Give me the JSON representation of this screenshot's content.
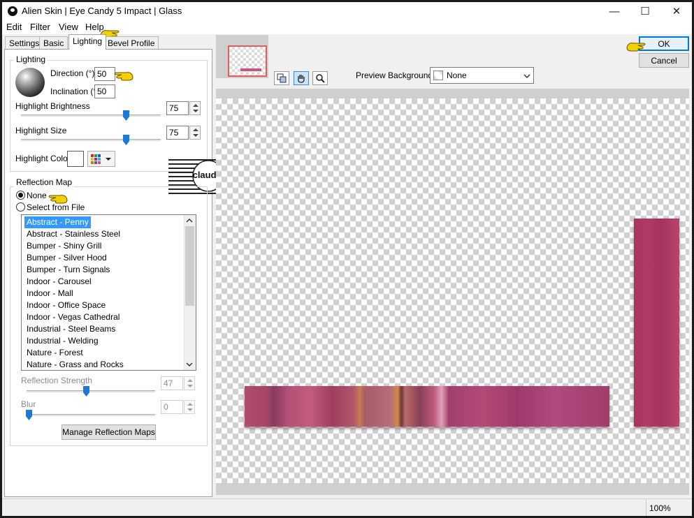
{
  "window": {
    "title": "Alien Skin | Eye Candy 5 Impact | Glass",
    "minimize": "—",
    "maximize": "☐",
    "close": "✕"
  },
  "menu": [
    "Edit",
    "Filter",
    "View",
    "Help"
  ],
  "tabs": [
    "Settings",
    "Basic",
    "Lighting",
    "Bevel Profile"
  ],
  "active_tab": "Lighting",
  "lighting": {
    "group_label": "Lighting",
    "direction_label": "Direction (°)",
    "direction_value": "50",
    "inclination_label": "Inclination (°)",
    "inclination_value": "50",
    "highlight_brightness_label": "Highlight Brightness",
    "highlight_brightness_value": "75",
    "highlight_brightness_level": 75,
    "highlight_size_label": "Highlight Size",
    "highlight_size_value": "75",
    "highlight_size_level": 75,
    "highlight_color_label": "Highlight Color",
    "highlight_color": "#ffffff"
  },
  "reflection": {
    "group_label": "Reflection Map",
    "option_none": "None",
    "option_file": "Select from File",
    "selected_option": "None",
    "maps": [
      "Abstract - Penny",
      "Abstract - Stainless Steel",
      "Bumper - Shiny Grill",
      "Bumper - Silver Hood",
      "Bumper - Turn Signals",
      "Indoor - Carousel",
      "Indoor - Mall",
      "Indoor - Office Space",
      "Indoor - Vegas Cathedral",
      "Industrial - Steel Beams",
      "Industrial - Welding",
      "Nature - Forest",
      "Nature - Grass and Rocks"
    ],
    "selected_map": "Abstract - Penny",
    "strength_label": "Reflection Strength",
    "strength_value": "47",
    "blur_label": "Blur",
    "blur_value": "0",
    "manage_button": "Manage Reflection Maps"
  },
  "actions": {
    "ok": "OK",
    "cancel": "Cancel"
  },
  "preview": {
    "background_label": "Preview Background:",
    "background_value": "None",
    "bar_color": "#b34a72"
  },
  "watermark": {
    "text": "claudia"
  },
  "status": {
    "zoom": "100%"
  }
}
